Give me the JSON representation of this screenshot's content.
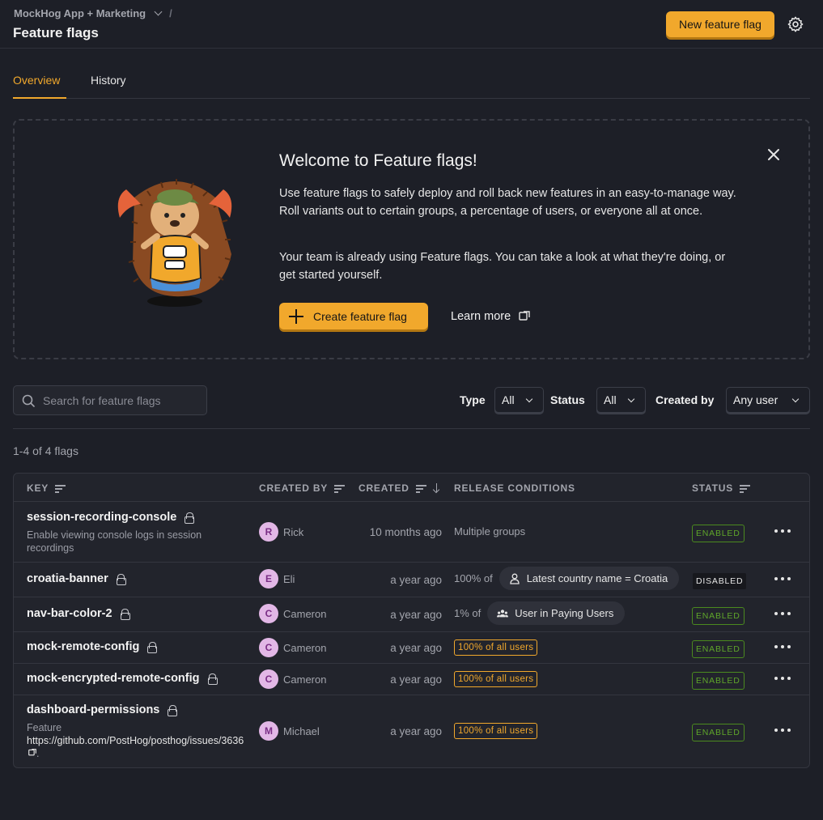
{
  "header": {
    "breadcrumb_project": "MockHog App + Marketing",
    "breadcrumb_sep": "/",
    "title": "Feature flags",
    "new_flag_label": "New feature flag"
  },
  "tabs": [
    {
      "label": "Overview",
      "active": true
    },
    {
      "label": "History",
      "active": false
    }
  ],
  "welcome": {
    "title": "Welcome to Feature flags!",
    "p1": "Use feature flags to safely deploy and roll back new features in an easy-to-manage way. Roll variants out to certain groups, a percentage of users, or everyone all at once.",
    "p2": "Your team is already using Feature flags. You can take a look at what they're doing, or get started yourself.",
    "create_label": "Create feature flag",
    "learn_more_label": "Learn more"
  },
  "filters": {
    "search_placeholder": "Search for feature flags",
    "type_label": "Type",
    "type_value": "All",
    "status_label": "Status",
    "status_value": "All",
    "created_by_label": "Created by",
    "created_by_value": "Any user"
  },
  "count_text": "1-4 of 4 flags",
  "table": {
    "headers": {
      "key": "KEY",
      "created_by": "CREATED BY",
      "created": "CREATED",
      "release_conditions": "RELEASE CONDITIONS",
      "status": "STATUS"
    },
    "rows": [
      {
        "key": "session-recording-console",
        "description": "Enable viewing console logs in session recordings",
        "initial": "R",
        "user": "Rick",
        "created": "10 months ago",
        "condition": "Multiple groups",
        "status": "ENABLED"
      },
      {
        "key": "croatia-banner",
        "initial": "E",
        "user": "Eli",
        "created": "a year ago",
        "condition_prefix": "100% of",
        "condition_pill": "Latest country name = Croatia",
        "status": "DISABLED"
      },
      {
        "key": "nav-bar-color-2",
        "initial": "C",
        "user": "Cameron",
        "created": "a year ago",
        "condition_prefix": "1% of",
        "condition_pill": "User in Paying Users",
        "status": "ENABLED"
      },
      {
        "key": "mock-remote-config",
        "initial": "C",
        "user": "Cameron",
        "created": "a year ago",
        "condition_badge": "100% of all users",
        "status": "ENABLED"
      },
      {
        "key": "mock-encrypted-remote-config",
        "initial": "C",
        "user": "Cameron",
        "created": "a year ago",
        "condition_badge": "100% of all users",
        "status": "ENABLED"
      },
      {
        "key": "dashboard-permissions",
        "description_prefix": "Feature",
        "description_link": "https://github.com/PostHog/posthog/issues/3636",
        "description_suffix": ".",
        "initial": "M",
        "user": "Michael",
        "created": "a year ago",
        "condition_badge": "100% of all users",
        "status": "ENABLED"
      }
    ]
  },
  "colors": {
    "accent": "#f1a82c",
    "enabled": "#5fa62a",
    "background": "#1d1f27"
  }
}
